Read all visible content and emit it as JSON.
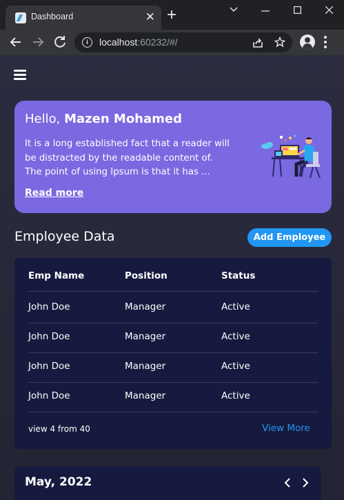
{
  "browser": {
    "tab_title": "Dashboard",
    "tab_close": "✕",
    "new_tab": "+",
    "url_host": "localhost",
    "url_rest": ":60232/#/"
  },
  "hero": {
    "greeting_prefix": "Hello, ",
    "user_name": "Mazen Mohamed",
    "text": "It is a long established fact that a reader will be distracted by the readable content of. The point of using Ipsum is that it has ...",
    "read_more": "Read more"
  },
  "employees": {
    "title": "Employee Data",
    "add_button": "Add Employee",
    "columns": [
      "Emp Name",
      "Position",
      "Status"
    ],
    "rows": [
      [
        "John Doe",
        "Manager",
        "Active"
      ],
      [
        "John Doe",
        "Manager",
        "Active"
      ],
      [
        "John Doe",
        "Manager",
        "Active"
      ],
      [
        "John Doe",
        "Manager",
        "Active"
      ]
    ],
    "footer_text": "view 4 from 40",
    "view_more": "View More"
  },
  "calendar": {
    "month_label": "May, 2022",
    "prev": "‹",
    "next": "›"
  },
  "colors": {
    "hero_bg": "#7a69e0",
    "accent_blue": "#2196f3",
    "card_bg": "#161a3e"
  }
}
